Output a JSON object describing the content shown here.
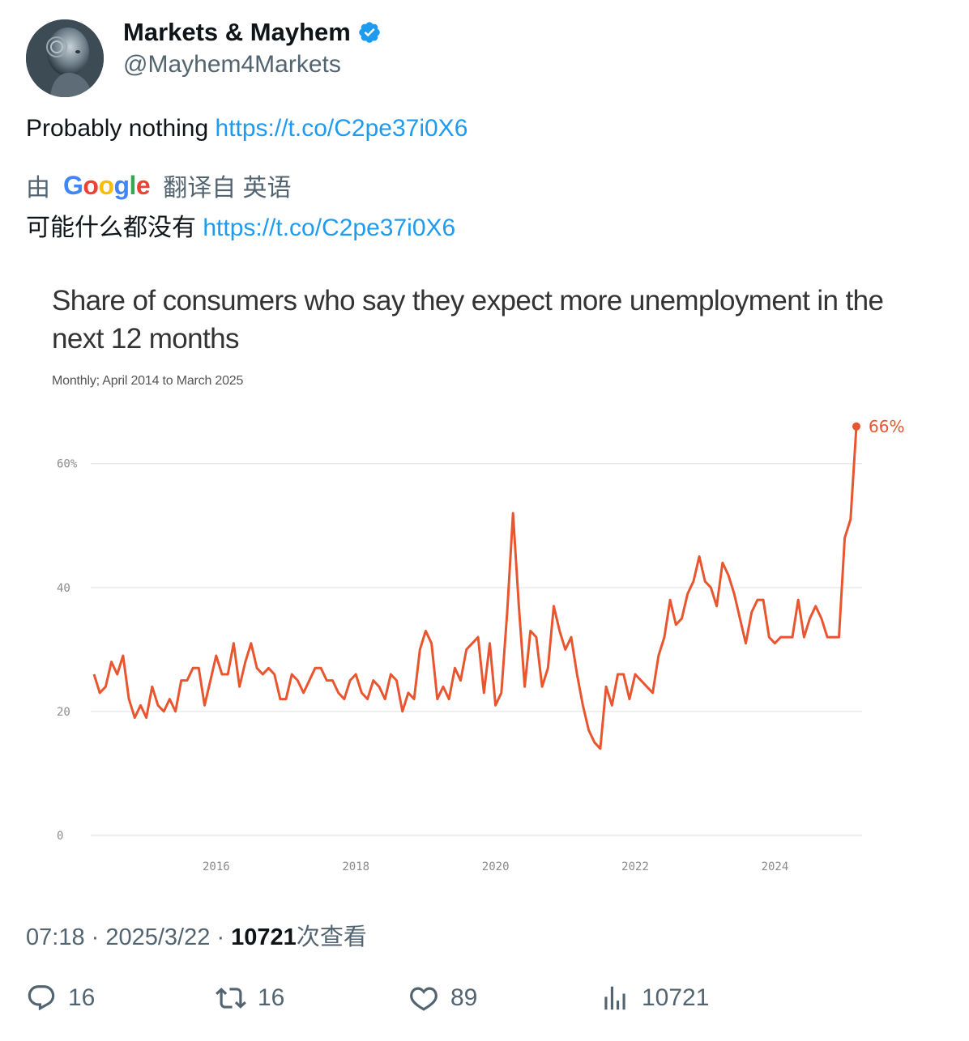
{
  "author": {
    "display_name": "Markets & Mayhem",
    "handle": "@Mayhem4Markets",
    "verified": true
  },
  "tweet": {
    "text": "Probably nothing",
    "link": "https://t.co/C2pe37i0X6"
  },
  "translation": {
    "prefix": "由",
    "brand": "Google",
    "suffix": "翻译自 英语",
    "text": "可能什么都没有",
    "link": "https://t.co/C2pe37i0X6"
  },
  "chart_data": {
    "type": "line",
    "title": "Share of consumers who say they expect more unemployment in the next 12 months",
    "subtitle": "Monthly; April 2014 to March 2025",
    "y_ticks": [
      "0",
      "20",
      "40",
      "60%"
    ],
    "y_tick_values": [
      0,
      20,
      40,
      60
    ],
    "x_ticks": [
      "2016",
      "2018",
      "2020",
      "2022",
      "2024"
    ],
    "x_tick_values": [
      2016,
      2018,
      2020,
      2022,
      2024
    ],
    "xlim": [
      "2014-04",
      "2025-03"
    ],
    "ylim": [
      0,
      66
    ],
    "grid": true,
    "color": "#e8552e",
    "end_label": "66%",
    "series": [
      {
        "values": [
          26,
          23,
          24,
          28,
          26,
          29,
          22,
          19,
          21,
          19,
          24,
          21,
          20,
          22,
          20,
          25,
          25,
          27,
          27,
          21,
          25,
          29,
          26,
          26,
          31,
          24,
          28,
          31,
          27,
          26,
          27,
          26,
          22,
          22,
          26,
          25,
          23,
          25,
          27,
          27,
          25,
          25,
          23,
          22,
          25,
          26,
          23,
          22,
          25,
          24,
          22,
          26,
          25,
          20,
          23,
          22,
          30,
          33,
          31,
          22,
          24,
          22,
          27,
          25,
          30,
          31,
          32,
          23,
          31,
          21,
          23,
          36,
          52,
          37,
          24,
          33,
          32,
          24,
          27,
          37,
          33,
          30,
          32,
          26,
          21,
          17,
          15,
          14,
          24,
          21,
          26,
          26,
          22,
          26,
          25,
          24,
          23,
          29,
          32,
          38,
          34,
          35,
          39,
          41,
          45,
          41,
          40,
          37,
          44,
          42,
          39,
          35,
          31,
          36,
          38,
          38,
          32,
          31,
          32,
          32,
          32,
          38,
          32,
          35,
          37,
          35,
          32,
          32,
          32,
          48,
          51,
          66
        ]
      }
    ]
  },
  "meta": {
    "time": "07:18",
    "date": "2025/3/22",
    "views": "10721",
    "views_suffix": "次查看"
  },
  "actions": {
    "replies": "16",
    "reposts": "16",
    "likes": "89",
    "views": "10721"
  },
  "colors": {
    "link": "#1d9bf0",
    "secondary_text": "#536471",
    "verified": "#1d9bf0",
    "chart_line": "#e8552e"
  },
  "icons": [
    "verified-badge-icon",
    "reply-icon",
    "repost-icon",
    "like-icon",
    "views-icon"
  ]
}
